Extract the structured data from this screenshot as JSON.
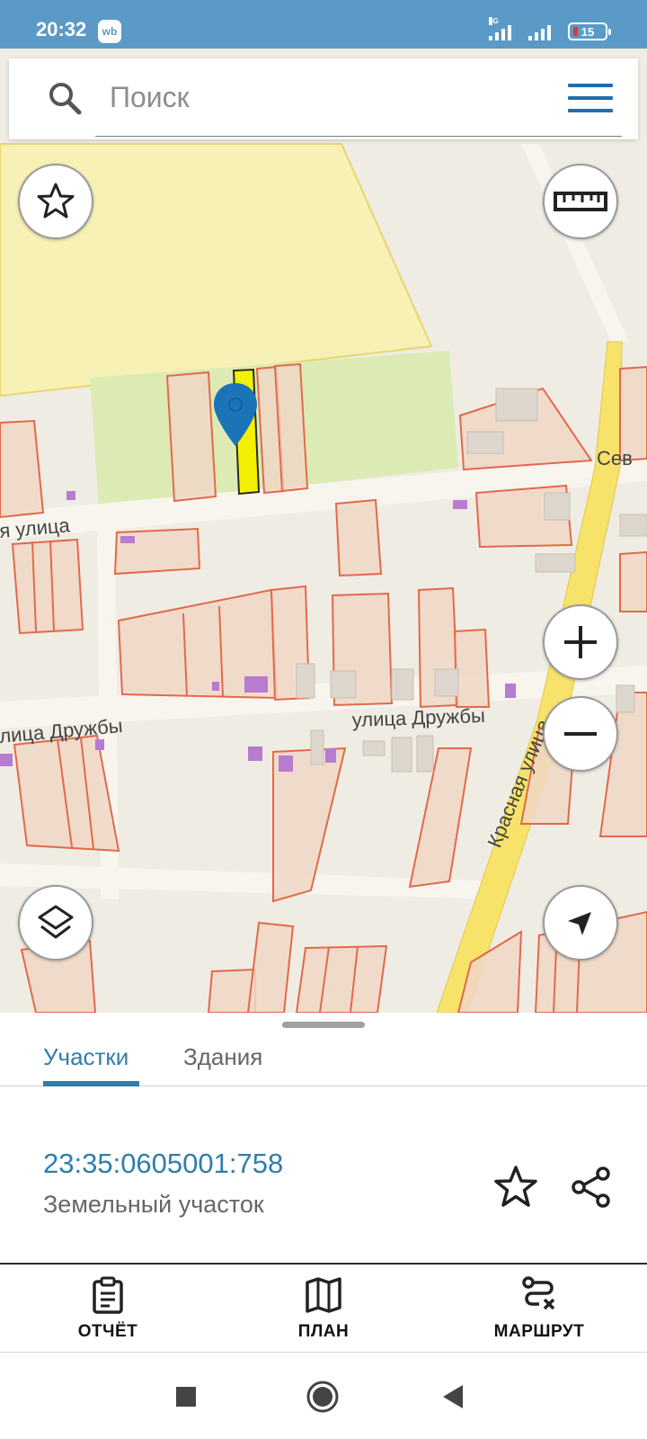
{
  "status_bar": {
    "time": "20:32",
    "app_badge": "wb",
    "network_tag": "4G",
    "battery_level": "15"
  },
  "search": {
    "placeholder": "Поиск"
  },
  "map": {
    "street_labels": [
      "я улица",
      "Сев",
      "лица Дружбы",
      "улица Дружбы",
      "Красная улица"
    ],
    "colors": {
      "background": "#efece3",
      "agricultural": "#f7f1b5",
      "green_area": "#dcebb3",
      "parcel_fill": "#f0d7c6",
      "parcel_stroke": "#e26a4a",
      "selected_parcel_fill": "#f3f000",
      "main_road": "#f7e36a",
      "pin": "#1b73b8",
      "building": "#b77bd0"
    }
  },
  "sheet": {
    "tabs": [
      {
        "label": "Участки",
        "active": true
      },
      {
        "label": "Здания",
        "active": false
      }
    ],
    "parcel": {
      "cadastral_number": "23:35:0605001:758",
      "type": "Земельный участок"
    }
  },
  "actions": [
    {
      "icon": "clipboard-icon",
      "label": "ОТЧЁТ"
    },
    {
      "icon": "map-icon",
      "label": "ПЛАН"
    },
    {
      "icon": "route-icon",
      "label": "МАРШРУТ"
    }
  ],
  "map_controls": [
    "star-icon",
    "ruler-icon",
    "layers-icon",
    "zoom-in-icon",
    "zoom-out-icon",
    "navigation-icon"
  ]
}
